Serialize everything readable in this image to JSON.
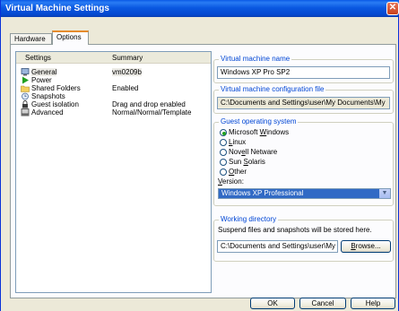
{
  "window": {
    "title": "Virtual Machine Settings",
    "close_glyph": "✕"
  },
  "tabs": [
    {
      "label": "Hardware"
    },
    {
      "label": "Options"
    }
  ],
  "settings_list": {
    "headers": {
      "settings": "Settings",
      "summary": "Summary"
    },
    "rows": [
      {
        "label": "General",
        "summary": "vm0209b",
        "icon": "monitor-icon"
      },
      {
        "label": "Power",
        "summary": "",
        "icon": "play-icon"
      },
      {
        "label": "Shared Folders",
        "summary": "Enabled",
        "icon": "folder-icon"
      },
      {
        "label": "Snapshots",
        "summary": "",
        "icon": "snapshot-icon"
      },
      {
        "label": "Guest isolation",
        "summary": "Drag and drop enabled",
        "icon": "lock-icon"
      },
      {
        "label": "Advanced",
        "summary": "Normal/Normal/Template",
        "icon": "computer-icon"
      }
    ]
  },
  "vm_name": {
    "title": "Virtual machine name",
    "value": "Windows XP Pro SP2"
  },
  "config_file": {
    "title": "Virtual machine configuration file",
    "value": "C:\\Documents and Settings\\user\\My Documents\\My"
  },
  "guest_os": {
    "title": "Guest operating system",
    "options": [
      {
        "pre": "Microsoft ",
        "key": "W",
        "post": "indows",
        "selected": true
      },
      {
        "pre": "",
        "key": "L",
        "post": "inux",
        "selected": false
      },
      {
        "pre": "Nov",
        "key": "e",
        "post": "ll Netware",
        "selected": false
      },
      {
        "pre": "Sun ",
        "key": "S",
        "post": "olaris",
        "selected": false
      },
      {
        "pre": "",
        "key": "O",
        "post": "ther",
        "selected": false
      }
    ],
    "version_label_key": "V",
    "version_label_rest": "ersion:",
    "version_value": "Windows XP Professional"
  },
  "working_dir": {
    "title": "Working directory",
    "description": "Suspend files and snapshots will be stored here.",
    "value": "C:\\Documents and Settings\\user\\My",
    "browse_key": "B",
    "browse_rest": "rowse..."
  },
  "buttons": {
    "ok": "OK",
    "cancel": "Cancel",
    "help": "Help"
  },
  "colors": {
    "titlebar": "#0a58e1",
    "group_title": "#0046d5",
    "selection": "#316ac5"
  }
}
